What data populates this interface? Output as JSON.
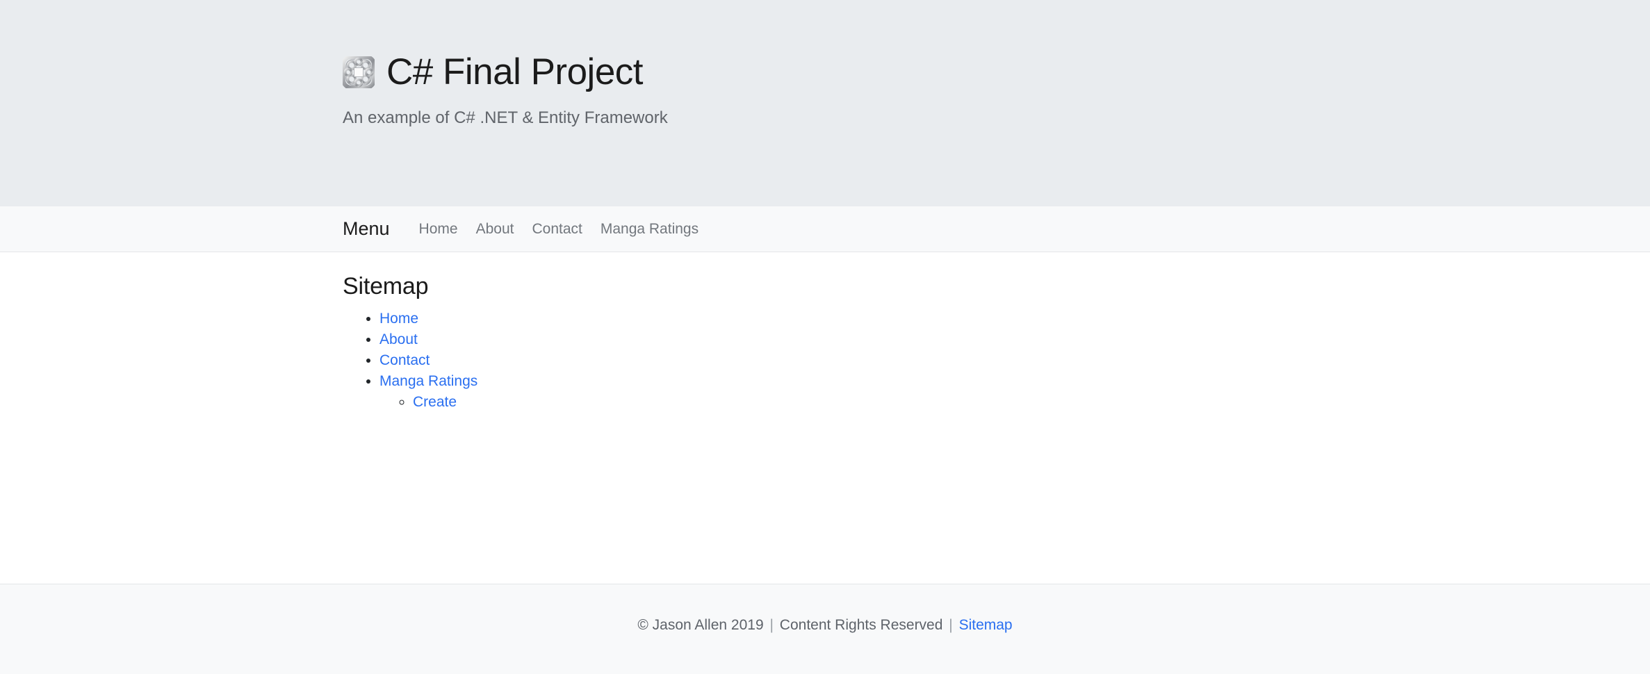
{
  "hero": {
    "logo_icon": "chain-link-knot-icon",
    "title": "C# Final Project",
    "subtitle": "An example of C# .NET & Entity Framework",
    "background_color": "#e9ecef"
  },
  "navbar": {
    "brand_label": "Menu",
    "background_color": "#f8f9fa",
    "links": [
      {
        "label": "Home"
      },
      {
        "label": "About"
      },
      {
        "label": "Contact"
      },
      {
        "label": "Manga Ratings"
      }
    ]
  },
  "main": {
    "heading": "Sitemap",
    "link_color": "#2a6ff0",
    "items": [
      {
        "label": "Home"
      },
      {
        "label": "About"
      },
      {
        "label": "Contact"
      },
      {
        "label": "Manga Ratings",
        "children": [
          {
            "label": "Create"
          }
        ]
      }
    ]
  },
  "footer": {
    "copyright": "© Jason Allen 2019",
    "separator_1": "|",
    "rights": "Content Rights Reserved",
    "separator_2": "|",
    "sitemap_label": "Sitemap",
    "background_color": "#f8f9fa"
  }
}
